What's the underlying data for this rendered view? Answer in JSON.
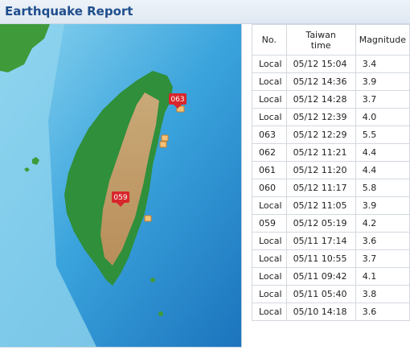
{
  "header": {
    "title": "Earthquake Report"
  },
  "map": {
    "markers": [
      {
        "label": "063",
        "kind": "numbered"
      },
      {
        "label": "059",
        "kind": "numbered"
      }
    ]
  },
  "table": {
    "columns": {
      "no": "No.",
      "time_line1": "Taiwan",
      "time_line2": "time",
      "magnitude": "Magnitude"
    },
    "rows": [
      {
        "no": "Local",
        "time": "05/12 15:04",
        "magnitude": "3.4"
      },
      {
        "no": "Local",
        "time": "05/12 14:36",
        "magnitude": "3.9"
      },
      {
        "no": "Local",
        "time": "05/12 14:28",
        "magnitude": "3.7"
      },
      {
        "no": "Local",
        "time": "05/12 12:39",
        "magnitude": "4.0"
      },
      {
        "no": "063",
        "time": "05/12 12:29",
        "magnitude": "5.5"
      },
      {
        "no": "062",
        "time": "05/12 11:21",
        "magnitude": "4.4"
      },
      {
        "no": "061",
        "time": "05/12 11:20",
        "magnitude": "4.4"
      },
      {
        "no": "060",
        "time": "05/12 11:17",
        "magnitude": "5.8"
      },
      {
        "no": "Local",
        "time": "05/12 11:05",
        "magnitude": "3.9"
      },
      {
        "no": "059",
        "time": "05/12 05:19",
        "magnitude": "4.2"
      },
      {
        "no": "Local",
        "time": "05/11 17:14",
        "magnitude": "3.6"
      },
      {
        "no": "Local",
        "time": "05/11 10:55",
        "magnitude": "3.7"
      },
      {
        "no": "Local",
        "time": "05/11 09:42",
        "magnitude": "4.1"
      },
      {
        "no": "Local",
        "time": "05/11 05:40",
        "magnitude": "3.8"
      },
      {
        "no": "Local",
        "time": "05/10 14:18",
        "magnitude": "3.6"
      }
    ]
  },
  "colors": {
    "title": "#1f4e8c",
    "marker": "#d7262c",
    "deep_sea": "#1f86c9",
    "shallow_sea": "#7fd0ee",
    "lowland": "#2e8b3a",
    "highland": "#c8a06a"
  }
}
